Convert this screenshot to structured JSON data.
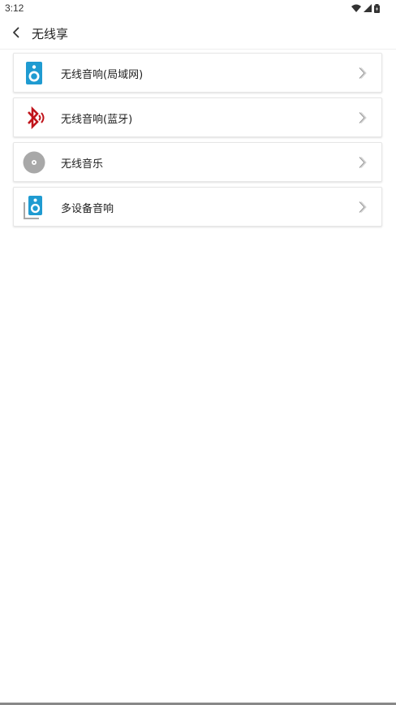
{
  "status_bar": {
    "time": "3:12"
  },
  "header": {
    "title": "无线享"
  },
  "menu": {
    "items": [
      {
        "label": "无线音响(局域网)",
        "icon": "speaker-icon"
      },
      {
        "label": "无线音响(蓝牙)",
        "icon": "bluetooth-icon"
      },
      {
        "label": "无线音乐",
        "icon": "disc-icon"
      },
      {
        "label": "多设备音响",
        "icon": "multi-speaker-icon"
      }
    ]
  },
  "colors": {
    "speaker_blue": "#1f9bd1",
    "bluetooth_red": "#c0141b",
    "disc_gray": "#a8a8a8"
  }
}
